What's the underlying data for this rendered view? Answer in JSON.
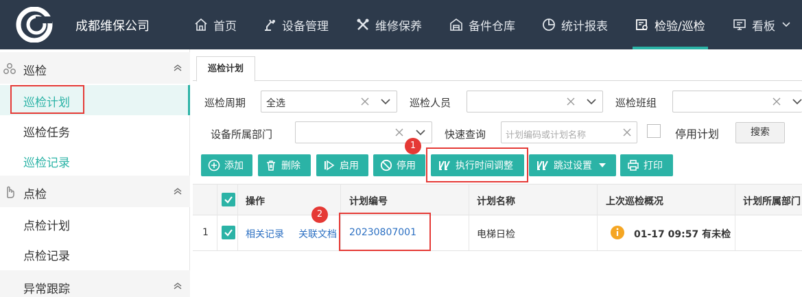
{
  "app": {
    "brand": "成都维保公司",
    "nav": [
      {
        "label": "首页",
        "icon": "home-icon"
      },
      {
        "label": "设备管理",
        "icon": "robot-arm-icon"
      },
      {
        "label": "维修保养",
        "icon": "tools-icon"
      },
      {
        "label": "备件仓库",
        "icon": "warehouse-icon"
      },
      {
        "label": "统计报表",
        "icon": "pie-chart-icon"
      },
      {
        "label": "检验/巡检",
        "icon": "inspection-icon",
        "active": true
      },
      {
        "label": "看板",
        "icon": "dashboard-icon",
        "has_dropdown": true
      }
    ]
  },
  "sidebar": {
    "groups": [
      {
        "label": "巡检",
        "icon": "patrol-icon",
        "items": [
          "巡检计划",
          "巡检任务",
          "巡检记录"
        ]
      },
      {
        "label": "点检",
        "icon": "hand-check-icon",
        "items": [
          "点检计划",
          "点检记录"
        ]
      },
      {
        "label": "异常跟踪",
        "icon": "",
        "items": []
      }
    ],
    "active_item": "巡检计划"
  },
  "tab": {
    "label": "巡检计划"
  },
  "filters": {
    "cycle_label": "巡检周期",
    "cycle_value": "全选",
    "person_label": "巡检人员",
    "team_label": "巡检班组",
    "dept_label": "设备所属部门",
    "quick_label": "快速查询",
    "quick_placeholder": "计划编码或计划名称",
    "disabled_label": "停用计划",
    "search_label": "搜索"
  },
  "toolbar": {
    "add": "添加",
    "delete": "删除",
    "enable": "启用",
    "disable": "停用",
    "adjust_time": "执行时间调整",
    "skip_settings": "跳过设置",
    "print": "打印"
  },
  "annotations": {
    "badge1": "1",
    "badge2": "2"
  },
  "table": {
    "columns": [
      "操作",
      "计划编号",
      "计划名称",
      "上次巡检概况",
      "计划所属部门"
    ],
    "rows": [
      {
        "index": "1",
        "actions": [
          "相关记录",
          "关联文档"
        ],
        "plan_no": "20230807001",
        "plan_name": "电梯日检",
        "last_summary": "01-17 09:57 有未检"
      }
    ]
  },
  "colors": {
    "accent": "#2bb3a6",
    "topbar": "#2d3a4b",
    "highlight": "#e53935",
    "link": "#2b6fc2",
    "warning": "#f5a623"
  }
}
